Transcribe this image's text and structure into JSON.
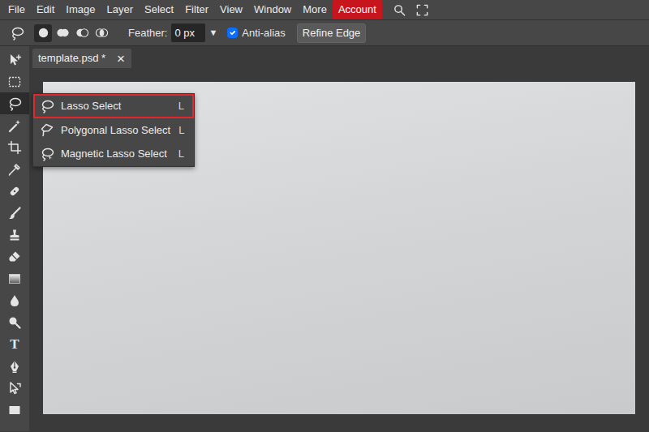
{
  "menu": [
    {
      "label": "File",
      "highlighted": false
    },
    {
      "label": "Edit",
      "highlighted": false
    },
    {
      "label": "Image",
      "highlighted": false
    },
    {
      "label": "Layer",
      "highlighted": false
    },
    {
      "label": "Select",
      "highlighted": false
    },
    {
      "label": "Filter",
      "highlighted": false
    },
    {
      "label": "View",
      "highlighted": false
    },
    {
      "label": "Window",
      "highlighted": false
    },
    {
      "label": "More",
      "highlighted": false
    },
    {
      "label": "Account",
      "highlighted": true
    }
  ],
  "options": {
    "modes": [
      {
        "selected": true
      },
      {
        "selected": false
      },
      {
        "selected": false
      },
      {
        "selected": false
      }
    ],
    "feather_label": "Feather:",
    "feather_value": "0 px",
    "dropdown_arrow": "▼",
    "anti_alias": {
      "label": "Anti-alias",
      "checked": true
    },
    "refine_button": "Refine Edge"
  },
  "tools": [
    {
      "selected": false
    },
    {
      "selected": false
    },
    {
      "selected": true
    },
    {
      "selected": false
    },
    {
      "selected": false
    },
    {
      "selected": false
    },
    {
      "selected": false
    },
    {
      "selected": false
    },
    {
      "selected": false
    },
    {
      "selected": false
    },
    {
      "selected": false
    },
    {
      "selected": false
    },
    {
      "selected": false
    },
    {
      "selected": false,
      "glyph": "T"
    },
    {
      "selected": false
    },
    {
      "selected": false
    },
    {
      "selected": false
    }
  ],
  "document_tab": {
    "title": "template.psd *",
    "close": "×"
  },
  "flyout": [
    {
      "label": "Lasso Select",
      "shortcut": "L",
      "selected": true
    },
    {
      "label": "Polygonal Lasso Select",
      "shortcut": "L",
      "selected": false
    },
    {
      "label": "Magnetic Lasso Select",
      "shortcut": "L",
      "selected": false
    }
  ]
}
